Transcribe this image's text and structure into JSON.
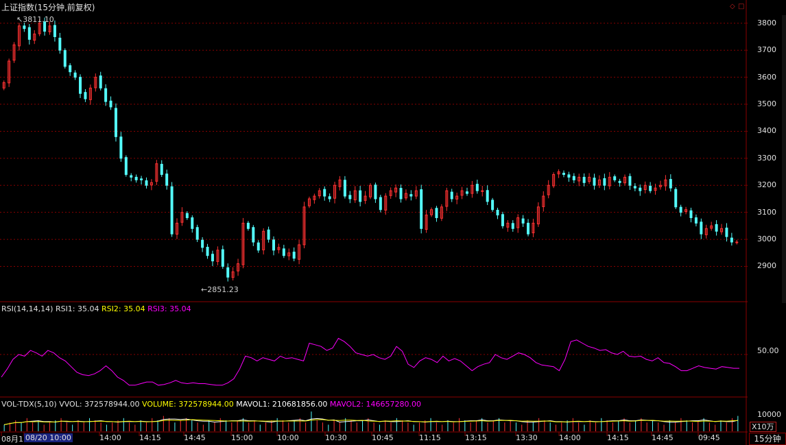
{
  "header": {
    "title": "上证指数(15分钟,前复权)"
  },
  "window_controls": {
    "restore": "◇",
    "close": "□"
  },
  "price_axis": {
    "labels": [
      "3800",
      "3700",
      "3600",
      "3500",
      "3400",
      "3300",
      "3200",
      "3100",
      "3000",
      "2900"
    ]
  },
  "annotations": {
    "high": "3811.10",
    "low": "2851.23"
  },
  "rsi_panel": {
    "name": "RSI(14,14,14)",
    "rsi1": "RSI1: 35.04",
    "rsi2": "RSI2: 35.04",
    "rsi3": "RSI3: 35.04",
    "axis_label": "50.00"
  },
  "vol_panel": {
    "name": "VOL-TDX(5,10)",
    "vvol": "VVOL: 372578944.00",
    "volume": "VOLUME: 372578944.00",
    "mavol1": "MAVOL1: 210681856.00",
    "mavol2": "MAVOL2: 146657280.00",
    "axis_label": "10000",
    "unit": "X10万"
  },
  "time_axis": {
    "labels": [
      "08月1",
      "08/20 10:00",
      "14:00",
      "14:15",
      "14:45",
      "15:00",
      "10:00",
      "10:30",
      "10:45",
      "11:15",
      "13:15",
      "13:30",
      "14:00",
      "14:15",
      "14:45",
      "09:45"
    ],
    "selected": "08/20 10:00"
  },
  "period_button": "15分钟",
  "colors": {
    "up": "#ff3232",
    "down": "#54fcfc",
    "rsi": "#ff00ff",
    "grid": "#8b0000",
    "mavol1": "#ffffff",
    "mavol2": "#ffff00"
  },
  "chart_data": {
    "type": "candlestick",
    "title": "上证指数(15分钟,前复权)",
    "ylim": [
      2820,
      3830
    ],
    "high": 3811.1,
    "low": 2851.23,
    "close_series": [
      3580,
      3660,
      3720,
      3790,
      3780,
      3740,
      3760,
      3800,
      3770,
      3790,
      3750,
      3700,
      3640,
      3620,
      3600,
      3540,
      3520,
      3560,
      3600,
      3560,
      3510,
      3490,
      3380,
      3300,
      3240,
      3230,
      3220,
      3220,
      3200,
      3210,
      3280,
      3240,
      3200,
      3020,
      3060,
      3100,
      3080,
      3040,
      3000,
      2970,
      2940,
      2920,
      2960,
      2900,
      2860,
      2880,
      2910,
      3060,
      3040,
      2990,
      2960,
      3030,
      3000,
      2960,
      2970,
      2940,
      2950,
      2930,
      2980,
      3120,
      3150,
      3160,
      3180,
      3160,
      3150,
      3200,
      3220,
      3160,
      3150,
      3180,
      3140,
      3160,
      3200,
      3150,
      3110,
      3160,
      3180,
      3190,
      3150,
      3170,
      3160,
      3180,
      3040,
      3090,
      3110,
      3080,
      3120,
      3180,
      3150,
      3160,
      3180,
      3170,
      3200,
      3180,
      3180,
      3140,
      3110,
      3090,
      3050,
      3060,
      3040,
      3080,
      3060,
      3020,
      3060,
      3120,
      3160,
      3200,
      3240,
      3250,
      3240,
      3230,
      3220,
      3230,
      3210,
      3230,
      3200,
      3220,
      3200,
      3230,
      3220,
      3210,
      3230,
      3200,
      3190,
      3180,
      3200,
      3180,
      3190,
      3200,
      3220,
      3190,
      3120,
      3100,
      3110,
      3080,
      3060,
      3020,
      3040,
      3050,
      3030,
      3040,
      3010,
      2990,
      2990
    ],
    "rsi": [
      22,
      32,
      44,
      50,
      48,
      55,
      52,
      48,
      55,
      52,
      46,
      42,
      35,
      28,
      25,
      24,
      26,
      30,
      36,
      30,
      22,
      18,
      12,
      12,
      14,
      16,
      16,
      12,
      13,
      15,
      18,
      15,
      14,
      15,
      14,
      14,
      13,
      12,
      12,
      15,
      20,
      32,
      48,
      46,
      42,
      46,
      44,
      42,
      48,
      45,
      46,
      44,
      42,
      64,
      62,
      60,
      55,
      58,
      70,
      66,
      60,
      52,
      50,
      48,
      50,
      46,
      44,
      48,
      60,
      54,
      38,
      34,
      42,
      46,
      44,
      40,
      48,
      42,
      45,
      42,
      36,
      30,
      35,
      38,
      40,
      50,
      46,
      44,
      48,
      52,
      50,
      46,
      40,
      37,
      36,
      35,
      30,
      44,
      66,
      68,
      64,
      60,
      58,
      55,
      56,
      52,
      50,
      54,
      48,
      47,
      48,
      44,
      42,
      46,
      40,
      39,
      35,
      30,
      30,
      33,
      36,
      34,
      33,
      32,
      35,
      34,
      33,
      33
    ],
    "volume_series": [
      3,
      4,
      5,
      4,
      6,
      4,
      5,
      3,
      4,
      5,
      6,
      4,
      3,
      5,
      4,
      6,
      5,
      4,
      3,
      4,
      5,
      6,
      4,
      3,
      5,
      4,
      6,
      5,
      7,
      6,
      4,
      5,
      6,
      5,
      4,
      3,
      5,
      4,
      6,
      5,
      4,
      5,
      6,
      4,
      5,
      3,
      4,
      5,
      6,
      5,
      4,
      5,
      6,
      4,
      9,
      5,
      4,
      3,
      5,
      4,
      6,
      5,
      4,
      5,
      6,
      4,
      3,
      5,
      4,
      6,
      5,
      4,
      3,
      4,
      5,
      6,
      4,
      3,
      5,
      4,
      6,
      5,
      4,
      5,
      6,
      4,
      5,
      6,
      4,
      5,
      4,
      3,
      5,
      4,
      6,
      5,
      4,
      3,
      4,
      5,
      6,
      4,
      3,
      5,
      4,
      6,
      5,
      4,
      5,
      6,
      4,
      5,
      6,
      4,
      5,
      4,
      3,
      5,
      4,
      6,
      5,
      4,
      5,
      6,
      4,
      3,
      5,
      4,
      6,
      7
    ],
    "rsi_ylim": [
      0,
      100
    ],
    "rsi_ref": 50
  }
}
